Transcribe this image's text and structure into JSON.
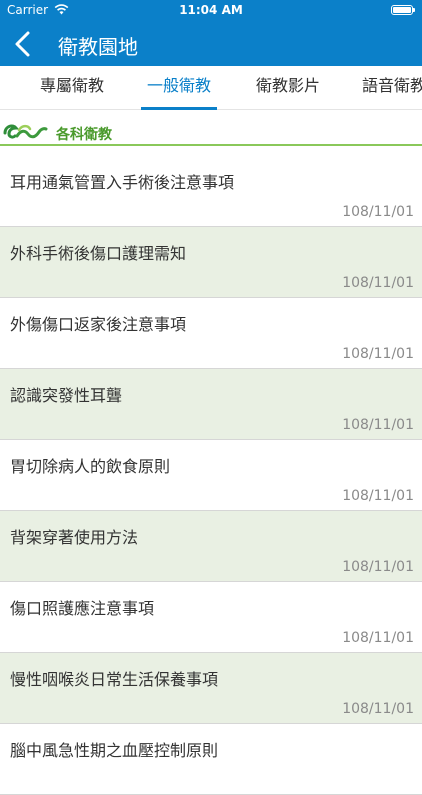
{
  "status_bar": {
    "carrier": "Carrier",
    "time": "11:04 AM"
  },
  "nav": {
    "title": "衛教園地"
  },
  "tabs": [
    {
      "label": "專屬衛教",
      "active": false
    },
    {
      "label": "一般衛教",
      "active": true
    },
    {
      "label": "衛教影片",
      "active": false
    },
    {
      "label": "語音衛教",
      "active": false
    }
  ],
  "section": {
    "label": "各科衛教"
  },
  "colors": {
    "brand_blue": "#0b80c9",
    "accent_green": "#8ac85a",
    "row_alt_bg": "#e9f0e3"
  },
  "items": [
    {
      "title": "耳用通氣管置入手術後注意事項",
      "date": "108/11/01"
    },
    {
      "title": "外科手術後傷口護理需知",
      "date": "108/11/01"
    },
    {
      "title": "外傷傷口返家後注意事項",
      "date": "108/11/01"
    },
    {
      "title": "認識突發性耳聾",
      "date": "108/11/01"
    },
    {
      "title": "胃切除病人的飲食原則",
      "date": "108/11/01"
    },
    {
      "title": "背架穿著使用方法",
      "date": "108/11/01"
    },
    {
      "title": "傷口照護應注意事項",
      "date": "108/11/01"
    },
    {
      "title": "慢性咽喉炎日常生活保養事項",
      "date": "108/11/01"
    },
    {
      "title": "腦中風急性期之血壓控制原則",
      "date": ""
    }
  ]
}
